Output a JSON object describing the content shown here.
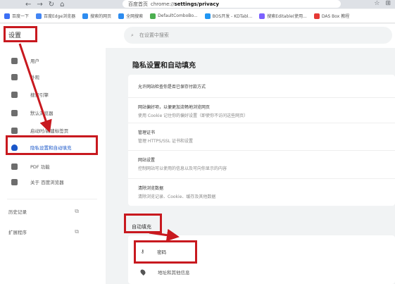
{
  "browser": {
    "url_prefix": "chrome://",
    "url_path": "settings/privacy",
    "page_label": "百度首页"
  },
  "bookmarks": [
    {
      "label": "百度一下",
      "color": "#3b6ff5"
    },
    {
      "label": "百度Edge浏览器",
      "color": "#4285f4"
    },
    {
      "label": "搜索的网页",
      "color": "#2d8cf0"
    },
    {
      "label": "全网搜索",
      "color": "#2d8cf0"
    },
    {
      "label": "DefaultComboBo...",
      "color": "#4caf50"
    },
    {
      "label": "BOS开发 - KDTabl...",
      "color": "#2196f3"
    },
    {
      "label": "搜索Editable(使用...",
      "color": "#7b61ff"
    },
    {
      "label": "DAS Box 教程",
      "color": "#e53935"
    }
  ],
  "header": {
    "settings_title": "设置",
    "search_placeholder": "在设置中搜索"
  },
  "sidebar": {
    "items": [
      {
        "label": "用户",
        "icon": "person-icon"
      },
      {
        "label": "外观",
        "icon": "palette-icon"
      },
      {
        "label": "搜索引擎",
        "icon": "wrench-icon"
      },
      {
        "label": "默认浏览器",
        "icon": "browser-icon"
      },
      {
        "label": "启动时/新建标签页",
        "icon": "power-icon"
      },
      {
        "label": "隐私设置和自动填充",
        "icon": "shield-icon",
        "active": true
      },
      {
        "label": "PDF 功能",
        "icon": "pdf-icon"
      },
      {
        "label": "关于 百度浏览器",
        "icon": "info-icon"
      }
    ],
    "bottom": [
      {
        "label": "历史记录",
        "icon": "external-link-icon"
      },
      {
        "label": "扩展程序",
        "icon": "external-link-icon"
      }
    ]
  },
  "main": {
    "section_title": "隐私设置和自动填充",
    "rows": [
      {
        "title": "允许网站检查你是否已保存付款方式",
        "sub": ""
      },
      {
        "title": "网站偏好项，以便更加流畅地浏览网页",
        "sub": "使用 Cookie 记住你的偏好设置（即使你不访问这些网页）"
      },
      {
        "title": "管理证书",
        "sub": "管理 HTTPS/SSL 证书和设置"
      },
      {
        "title": "网站设置",
        "sub": "控制网站可以使用的信息以及可向你显示的内容"
      },
      {
        "title": "清除浏览数据",
        "sub": "清除浏览记录、Cookie、缓存及其他数据"
      }
    ],
    "autofill_label": "自动填充",
    "autofill_items": [
      {
        "label": "密码",
        "icon": "key-icon"
      },
      {
        "label": "地址和其他信息",
        "icon": "location-pin-icon"
      }
    ]
  },
  "colors": {
    "annotation": "#c8191f",
    "active": "#1a57c9"
  }
}
